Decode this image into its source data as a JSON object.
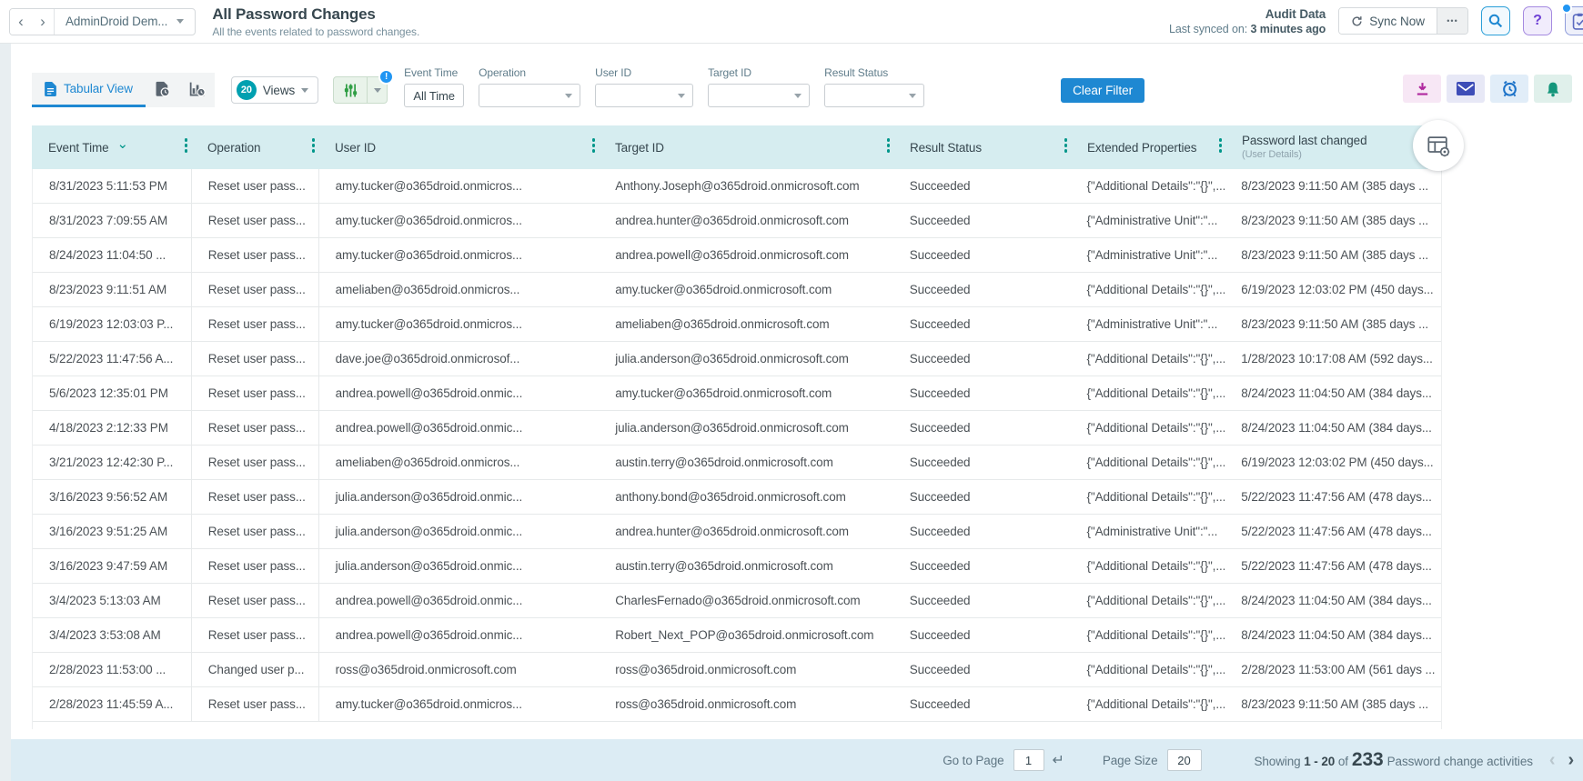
{
  "header": {
    "tenant_label": "AdminDroid Dem...",
    "title": "All Password Changes",
    "subtitle": "All the events related to password changes.",
    "audit_label": "Audit Data",
    "synced_prefix": "Last synced on: ",
    "synced_value": "3 minutes ago",
    "sync_label": "Sync Now"
  },
  "toolbar": {
    "tab_label": "Tabular View",
    "views_badge": "20",
    "views_label": "Views",
    "clear_filter_label": "Clear Filter",
    "filters": [
      {
        "label": "Event Time",
        "value": "All Time"
      },
      {
        "label": "Operation",
        "value": ""
      },
      {
        "label": "User ID",
        "value": ""
      },
      {
        "label": "Target ID",
        "value": ""
      },
      {
        "label": "Result Status",
        "value": ""
      }
    ]
  },
  "table": {
    "columns": [
      "Event Time",
      "Operation",
      "User ID",
      "Target ID",
      "Result Status",
      "Extended Properties",
      "Password last changed"
    ],
    "password_sub_label": "(User Details)",
    "rows": [
      [
        "8/31/2023 5:11:53 PM",
        "Reset user pass...",
        "amy.tucker@o365droid.onmicros...",
        "Anthony.Joseph@o365droid.onmicrosoft.com",
        "Succeeded",
        "{\"Additional Details\":\"{}\",...",
        "8/23/2023 9:11:50 AM (385 days ..."
      ],
      [
        "8/31/2023 7:09:55 AM",
        "Reset user pass...",
        "amy.tucker@o365droid.onmicros...",
        "andrea.hunter@o365droid.onmicrosoft.com",
        "Succeeded",
        "{\"Administrative Unit\":\"...",
        "8/23/2023 9:11:50 AM (385 days ..."
      ],
      [
        "8/24/2023 11:04:50 ...",
        "Reset user pass...",
        "amy.tucker@o365droid.onmicros...",
        "andrea.powell@o365droid.onmicrosoft.com",
        "Succeeded",
        "{\"Administrative Unit\":\"...",
        "8/23/2023 9:11:50 AM (385 days ..."
      ],
      [
        "8/23/2023 9:11:51 AM",
        "Reset user pass...",
        "ameliaben@o365droid.onmicros...",
        "amy.tucker@o365droid.onmicrosoft.com",
        "Succeeded",
        "{\"Additional Details\":\"{}\",...",
        "6/19/2023 12:03:02 PM (450 days..."
      ],
      [
        "6/19/2023 12:03:03 P...",
        "Reset user pass...",
        "amy.tucker@o365droid.onmicros...",
        "ameliaben@o365droid.onmicrosoft.com",
        "Succeeded",
        "{\"Administrative Unit\":\"...",
        "8/23/2023 9:11:50 AM (385 days ..."
      ],
      [
        "5/22/2023 11:47:56 A...",
        "Reset user pass...",
        "dave.joe@o365droid.onmicrosof...",
        "julia.anderson@o365droid.onmicrosoft.com",
        "Succeeded",
        "{\"Additional Details\":\"{}\",...",
        "1/28/2023 10:17:08 AM (592 days..."
      ],
      [
        "5/6/2023 12:35:01 PM",
        "Reset user pass...",
        "andrea.powell@o365droid.onmic...",
        "amy.tucker@o365droid.onmicrosoft.com",
        "Succeeded",
        "{\"Additional Details\":\"{}\",...",
        "8/24/2023 11:04:50 AM (384 days..."
      ],
      [
        "4/18/2023 2:12:33 PM",
        "Reset user pass...",
        "andrea.powell@o365droid.onmic...",
        "julia.anderson@o365droid.onmicrosoft.com",
        "Succeeded",
        "{\"Additional Details\":\"{}\",...",
        "8/24/2023 11:04:50 AM (384 days..."
      ],
      [
        "3/21/2023 12:42:30 P...",
        "Reset user pass...",
        "ameliaben@o365droid.onmicros...",
        "austin.terry@o365droid.onmicrosoft.com",
        "Succeeded",
        "{\"Additional Details\":\"{}\",...",
        "6/19/2023 12:03:02 PM (450 days..."
      ],
      [
        "3/16/2023 9:56:52 AM",
        "Reset user pass...",
        "julia.anderson@o365droid.onmic...",
        "anthony.bond@o365droid.onmicrosoft.com",
        "Succeeded",
        "{\"Additional Details\":\"{}\",...",
        "5/22/2023 11:47:56 AM (478 days..."
      ],
      [
        "3/16/2023 9:51:25 AM",
        "Reset user pass...",
        "julia.anderson@o365droid.onmic...",
        "andrea.hunter@o365droid.onmicrosoft.com",
        "Succeeded",
        "{\"Administrative Unit\":\"...",
        "5/22/2023 11:47:56 AM (478 days..."
      ],
      [
        "3/16/2023 9:47:59 AM",
        "Reset user pass...",
        "julia.anderson@o365droid.onmic...",
        "austin.terry@o365droid.onmicrosoft.com",
        "Succeeded",
        "{\"Additional Details\":\"{}\",...",
        "5/22/2023 11:47:56 AM (478 days..."
      ],
      [
        "3/4/2023 5:13:03 AM",
        "Reset user pass...",
        "andrea.powell@o365droid.onmic...",
        "CharlesFernado@o365droid.onmicrosoft.com",
        "Succeeded",
        "{\"Additional Details\":\"{}\",...",
        "8/24/2023 11:04:50 AM (384 days..."
      ],
      [
        "3/4/2023 3:53:08 AM",
        "Reset user pass...",
        "andrea.powell@o365droid.onmic...",
        "Robert_Next_POP@o365droid.onmicrosoft.com",
        "Succeeded",
        "{\"Additional Details\":\"{}\",...",
        "8/24/2023 11:04:50 AM (384 days..."
      ],
      [
        "2/28/2023 11:53:00 ...",
        "Changed user p...",
        "ross@o365droid.onmicrosoft.com",
        "ross@o365droid.onmicrosoft.com",
        "Succeeded",
        "{\"Additional Details\":\"{}\",...",
        "2/28/2023 11:53:00 AM (561 days ..."
      ],
      [
        "2/28/2023 11:45:59 A...",
        "Reset user pass...",
        "amy.tucker@o365droid.onmicros...",
        "ross@o365droid.onmicrosoft.com",
        "Succeeded",
        "{\"Additional Details\":\"{}\",...",
        "8/23/2023 9:11:50 AM (385 days ..."
      ]
    ]
  },
  "footer": {
    "goto_label": "Go to Page",
    "goto_value": "1",
    "page_size_label": "Page Size",
    "page_size_value": "20",
    "showing_label": "Showing",
    "range": "1 - 20",
    "of_label": "of",
    "total": "233",
    "unit_label": "Password change activities"
  },
  "glyphs": {
    "back": "‹",
    "forward": "›",
    "more": "•••",
    "help": "?",
    "enter": "↵",
    "prev": "‹",
    "next": "›",
    "alert": "!",
    "sort": "⌄"
  },
  "colors": {
    "accent_blue": "#1e88d2",
    "table_header_teal": "#d6edf0",
    "views_badge_teal": "#00a0b0",
    "footer_bg": "#dcecf4",
    "success_green_icon": "#2f9e44"
  }
}
